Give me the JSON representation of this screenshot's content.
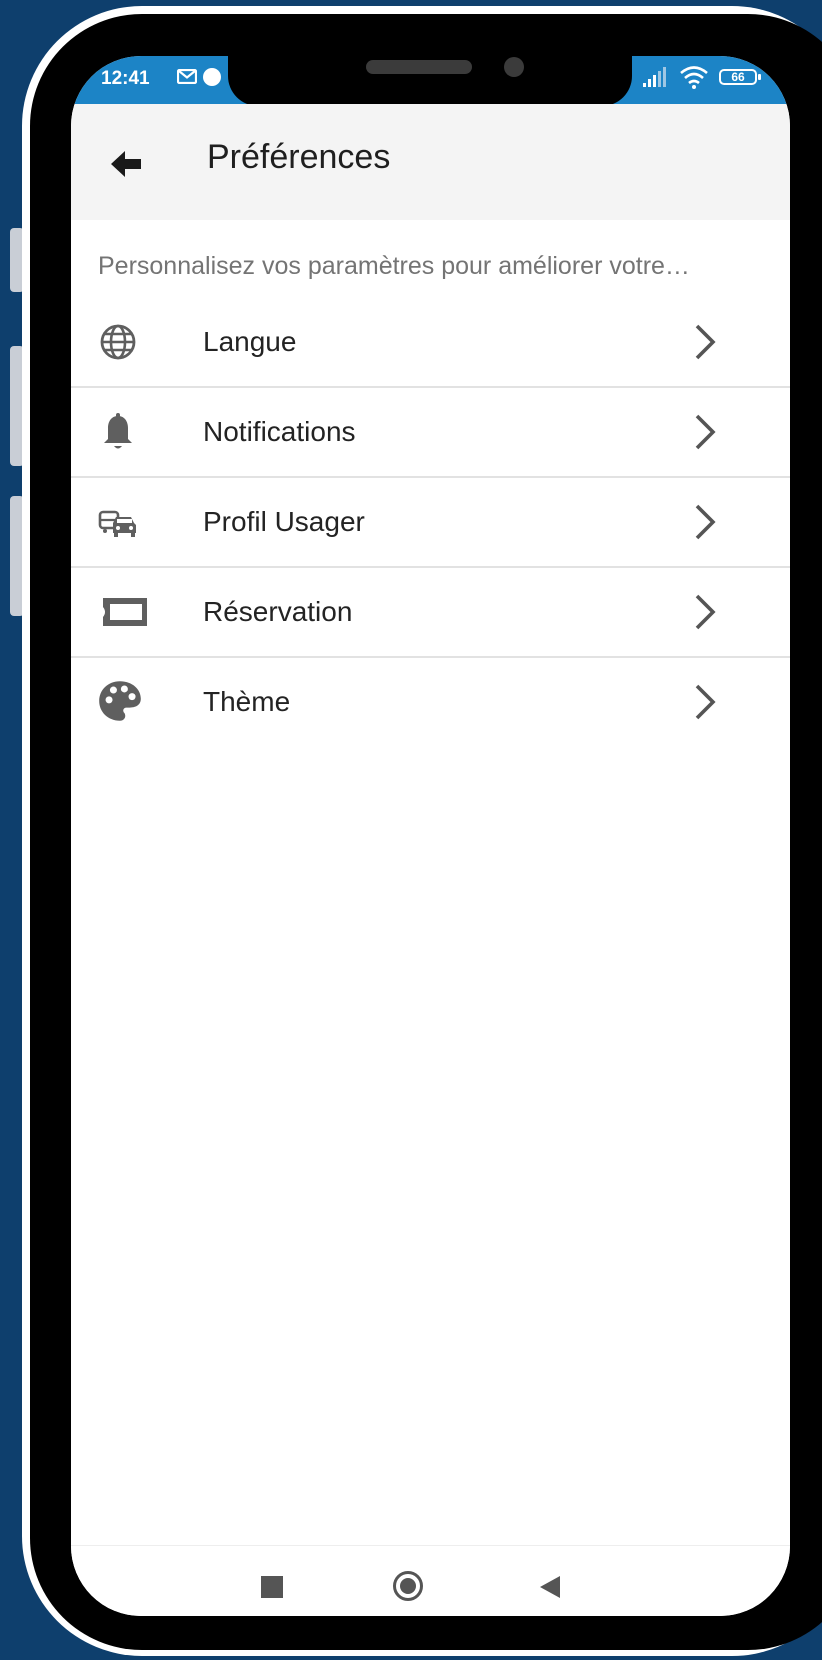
{
  "status_bar": {
    "time": "12:41",
    "battery": "66",
    "icons": [
      "mail-icon",
      "app-notification-icon",
      "signal-icon",
      "wifi-icon",
      "battery-icon"
    ]
  },
  "header": {
    "back_icon": "arrow-left-icon",
    "title": "Préférences"
  },
  "intro_text": "Personnalisez vos paramètres pour améliorer votre…",
  "menu": [
    {
      "label": "Langue",
      "icon": "globe-icon"
    },
    {
      "label": "Notifications",
      "icon": "bell-icon"
    },
    {
      "label": "Profil Usager",
      "icon": "transport-icon"
    },
    {
      "label": "Réservation",
      "icon": "ticket-icon"
    },
    {
      "label": "Thème",
      "icon": "palette-icon"
    }
  ],
  "nav_bar": {
    "icons": [
      "recents-square-icon",
      "home-circle-icon",
      "back-triangle-icon"
    ]
  },
  "colors": {
    "background": "#0e3f6d",
    "status_bar": "#1c84c6",
    "app_bar": "#f4f4f4",
    "icon_gray": "#5f5f5f"
  }
}
